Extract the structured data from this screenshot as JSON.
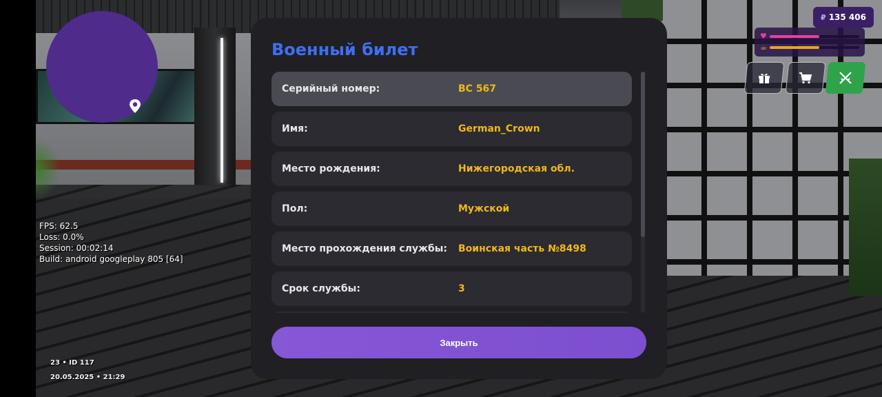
{
  "hud": {
    "money_currency": "₽",
    "money_value": "135 406",
    "health_level": 0.55,
    "hunger_level": 0.55,
    "buttons": [
      {
        "name": "gift-button",
        "icon": "gift-icon"
      },
      {
        "name": "shop-button",
        "icon": "cart-icon"
      },
      {
        "name": "weapons-button",
        "icon": "crossed-swords-icon"
      }
    ]
  },
  "debug": {
    "fps": "FPS: 62.5",
    "loss": "Loss: 0.0%",
    "session": "Session: 00:02:14",
    "build": "Build: android googleplay 805 [64]"
  },
  "footer": {
    "server": "23 • ID 117",
    "datetime": "20.05.2025 • 21:29"
  },
  "dialog": {
    "title": "Военный билет",
    "rows": [
      {
        "label": "Серийный номер:",
        "value": "ВС 567"
      },
      {
        "label": "Имя:",
        "value": "German_Crown"
      },
      {
        "label": "Место рождения:",
        "value": "Нижегородская обл."
      },
      {
        "label": "Пол:",
        "value": "Мужской"
      },
      {
        "label": "Место прохождения службы:",
        "value": "Воинская часть №8498"
      },
      {
        "label": "Срок службы:",
        "value": "3"
      }
    ],
    "close_label": "Закрыть"
  },
  "colors": {
    "title": "#3f6ff0",
    "value": "#f1b816",
    "close_button": "#8657d6",
    "minimap": "#4f2b8c",
    "health": "#e8409a",
    "hunger": "#f0a020"
  }
}
